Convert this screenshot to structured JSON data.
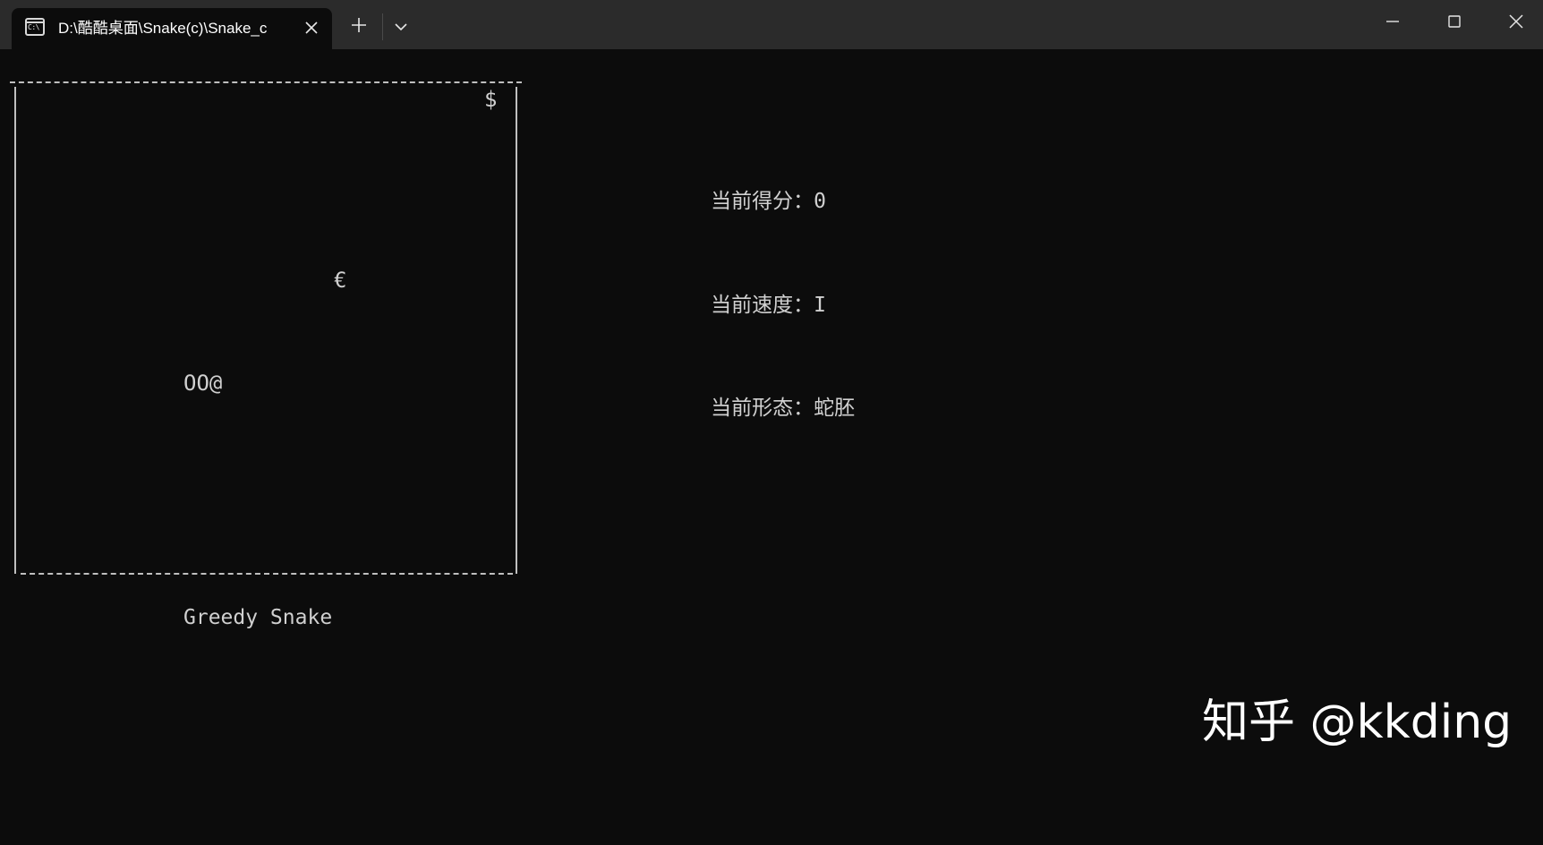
{
  "window": {
    "tab_title": "D:\\酷酷桌面\\Snake(c)\\Snake_c",
    "tab_icon_text": "C:\\",
    "icons": {
      "tab": "terminal-icon",
      "tab_close": "close-icon",
      "new_tab": "plus-icon",
      "dropdown": "chevron-down-icon",
      "minimize": "minimize-icon",
      "maximize": "maximize-icon",
      "close": "close-icon"
    }
  },
  "game": {
    "food_symbol": "$",
    "bonus_symbol": "€",
    "snake": "OO@",
    "title": "Greedy Snake"
  },
  "status": {
    "score_label": "当前得分：",
    "score_value": "0",
    "speed_label": "当前速度：",
    "speed_value": "I",
    "form_label": "当前形态：",
    "form_value": "蛇胚"
  },
  "watermark": "知乎 @kkding",
  "colors": {
    "titlebar": "#2b2b2b",
    "console_bg": "#0c0c0c",
    "text": "#cccccc"
  }
}
